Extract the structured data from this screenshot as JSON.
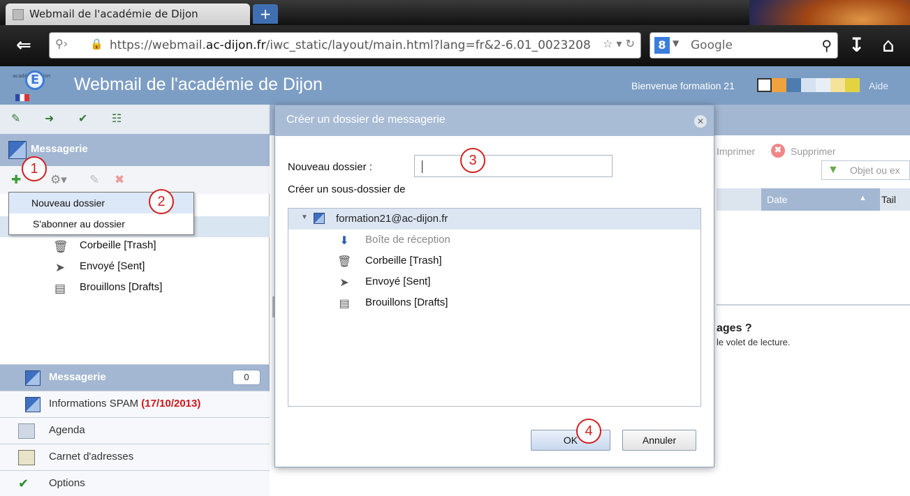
{
  "browser": {
    "tab_title": "Webmail de l'académie de Dijon",
    "new_tab_label": "+",
    "url_prefix": "https://webmail.",
    "url_domain": "ac-dijon.fr",
    "url_rest": "/iwc_static/layout/main.html?lang=fr&2-6.01_0023208",
    "search_placeholder": "Google",
    "search_engine_letter": "8"
  },
  "header": {
    "title": "Webmail de l'académie de Dijon",
    "welcome": "Bienvenue formation 21",
    "help": "Aide",
    "logo_text_small": "académie\nDijon",
    "logo_letter": "E",
    "theme_colors": [
      "#ffffff",
      "#f0a23c",
      "#4d7db0",
      "#d6e2f0",
      "#e8eef5",
      "#f5e39a",
      "#e3d340"
    ]
  },
  "left": {
    "section_title": "Messagerie",
    "context_menu": {
      "item1": "Nouveau dossier",
      "item2": "S'abonner au dossier"
    },
    "folders": [
      {
        "label": "Corbeille [Trash]",
        "icon": "trash-icon"
      },
      {
        "label": "Envoyé [Sent]",
        "icon": "paper-plane-icon"
      },
      {
        "label": "Brouillons [Drafts]",
        "icon": "drafts-icon"
      }
    ],
    "nav": {
      "messaging": "Messagerie",
      "messaging_count": "0",
      "spam_label": "Informations SPAM ",
      "spam_date": "(17/10/2013)",
      "calendar": "Agenda",
      "contacts": "Carnet d'adresses",
      "options": "Options"
    }
  },
  "right": {
    "print": "Imprimer",
    "delete": "Supprimer",
    "filter_placeholder": "Objet ou ex",
    "col_date": "Date",
    "col_size": "Tail",
    "prompt_title": "ages ?",
    "prompt_text": "le volet de lecture."
  },
  "dialog": {
    "title": "Créer un dossier de messagerie",
    "new_folder_label": "Nouveau dossier :",
    "new_folder_value": "",
    "subfolder_label": "Créer un sous-dossier de",
    "tree_root": "formation21@ac-dijon.fr",
    "tree_items": [
      {
        "label": "Boîte de réception",
        "icon": "inbox-icon"
      },
      {
        "label": "Corbeille [Trash]",
        "icon": "trash-icon"
      },
      {
        "label": "Envoyé [Sent]",
        "icon": "paper-plane-icon"
      },
      {
        "label": "Brouillons [Drafts]",
        "icon": "drafts-icon"
      }
    ],
    "ok": "OK",
    "cancel": "Annuler"
  },
  "steps": [
    "1",
    "2",
    "3",
    "4"
  ]
}
